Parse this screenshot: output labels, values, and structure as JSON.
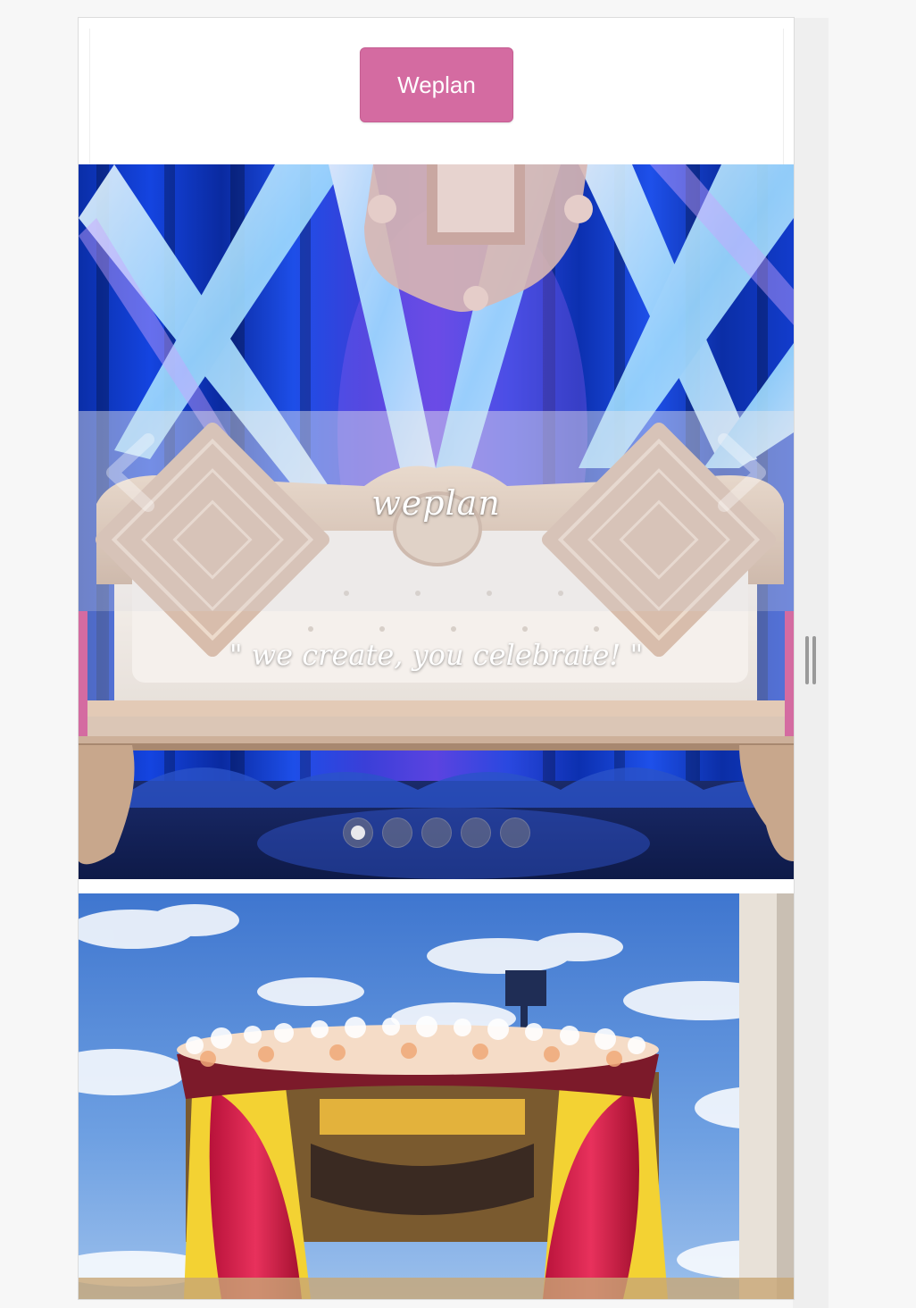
{
  "header": {
    "brand_button_label": "Weplan"
  },
  "hero": {
    "brand": "weplan",
    "tagline": "\" we create, you celebrate! \"",
    "slides_total": 5,
    "active_slide": 1,
    "dots": [
      {
        "label": "Slide 1"
      },
      {
        "label": "Slide 2"
      },
      {
        "label": "Slide 3"
      },
      {
        "label": "Slide 4"
      },
      {
        "label": "Slide 5"
      }
    ],
    "accent_color": "#d46ba1"
  },
  "icons": {
    "prev": "chevron-left-icon",
    "next": "chevron-right-icon",
    "resize": "resize-handle-icon"
  }
}
